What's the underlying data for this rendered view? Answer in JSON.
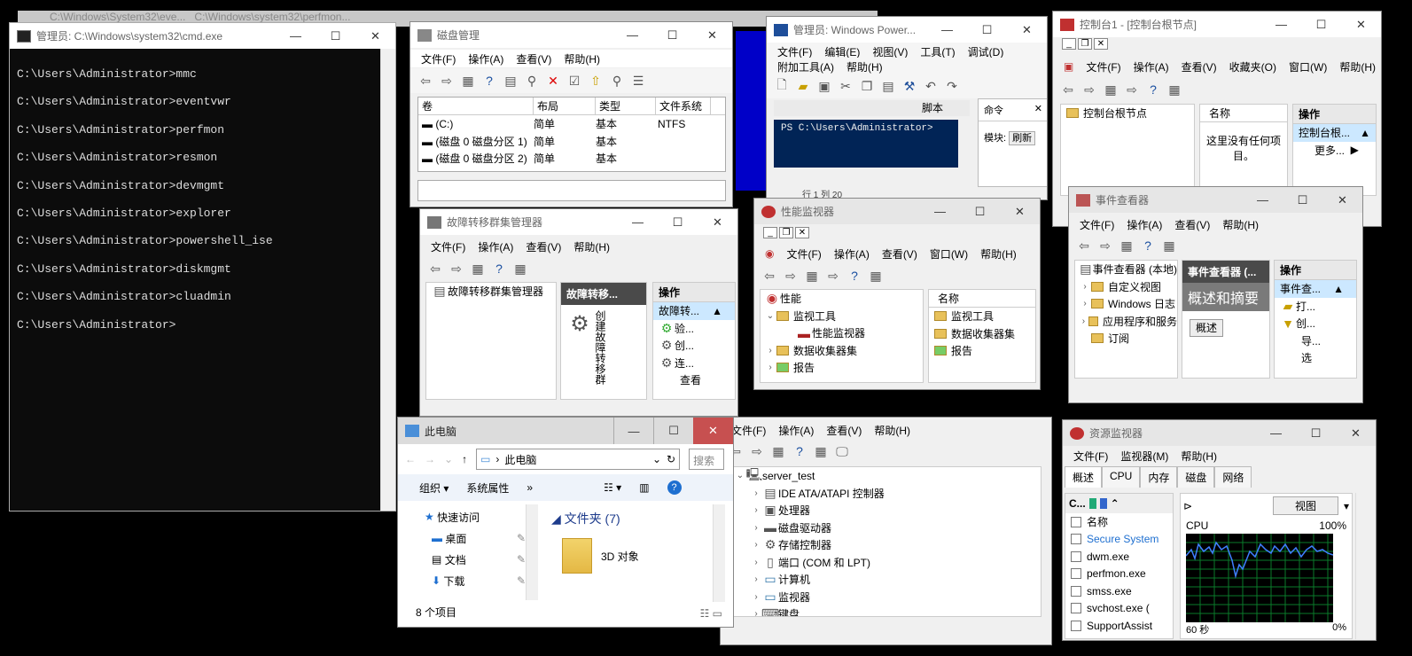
{
  "back_titles": {
    "a": "C:\\Windows\\System32\\eve...",
    "b": "C:\\Windows\\system32\\perfmon..."
  },
  "cmd": {
    "title": "管理员: C:\\Windows\\system32\\cmd.exe",
    "lines": [
      "C:\\Users\\Administrator>mmc",
      "C:\\Users\\Administrator>eventvwr",
      "C:\\Users\\Administrator>perfmon",
      "C:\\Users\\Administrator>resmon",
      "C:\\Users\\Administrator>devmgmt",
      "C:\\Users\\Administrator>explorer",
      "C:\\Users\\Administrator>powershell_ise",
      "C:\\Users\\Administrator>diskmgmt",
      "C:\\Users\\Administrator>cluadmin",
      "C:\\Users\\Administrator>"
    ]
  },
  "disk": {
    "title": "磁盘管理",
    "menu": [
      "文件(F)",
      "操作(A)",
      "查看(V)",
      "帮助(H)"
    ],
    "cols": [
      "卷",
      "布局",
      "类型",
      "文件系统"
    ],
    "rows": [
      [
        "(C:)",
        "简单",
        "基本",
        "NTFS"
      ],
      [
        "(磁盘 0 磁盘分区 1)",
        "简单",
        "基本",
        ""
      ],
      [
        "(磁盘 0 磁盘分区 2)",
        "简单",
        "基本",
        ""
      ]
    ]
  },
  "ps": {
    "title": "管理员: Windows Power...",
    "menu1": [
      "文件(F)",
      "编辑(E)",
      "视图(V)",
      "工具(T)",
      "调试(D)"
    ],
    "menu2": [
      "附加工具(A)",
      "帮助(H)"
    ],
    "script_label": "脚本",
    "prompt": "PS C:\\Users\\Administrator>",
    "cmd_tab": "命令",
    "module_label": "模块:",
    "module_value": "刷新",
    "status": "行 1  列 20"
  },
  "mmc": {
    "title": "控制台1 - [控制台根节点]",
    "menu": [
      "文件(F)",
      "操作(A)",
      "查看(V)",
      "收藏夹(O)",
      "窗口(W)",
      "帮助(H)"
    ],
    "tree_root": "控制台根节点",
    "col_name": "名称",
    "empty": "这里没有任何项目。",
    "actions_header": "操作",
    "action_selected": "控制台根...",
    "action_more": "更多..."
  },
  "cluster": {
    "title": "故障转移群集管理器",
    "menu": [
      "文件(F)",
      "操作(A)",
      "查看(V)",
      "帮助(H)"
    ],
    "tree_root": "故障转移群集管理器",
    "center_header": "故障转移...",
    "create_text": "创建故障转移群",
    "actions_header": "操作",
    "action_selected": "故障转...",
    "actions": [
      "验...",
      "创...",
      "连...",
      "查看"
    ]
  },
  "perf": {
    "title": "性能监视器",
    "menu": [
      "文件(F)",
      "操作(A)",
      "查看(V)",
      "窗口(W)",
      "帮助(H)"
    ],
    "tree": [
      "性能",
      "监视工具",
      "性能监视器",
      "数据收集器集",
      "报告"
    ],
    "col_name": "名称",
    "items": [
      "监视工具",
      "数据收集器集",
      "报告"
    ]
  },
  "event": {
    "title": "事件查看器",
    "menu": [
      "文件(F)",
      "操作(A)",
      "查看(V)",
      "帮助(H)"
    ],
    "tree": [
      "事件查看器 (本地)",
      "自定义视图",
      "Windows 日志",
      "应用程序和服务",
      "订阅"
    ],
    "center_header": "事件查看器 (...",
    "overview": "概述和摘要",
    "overview_btn": "概述",
    "actions_header": "操作",
    "action_selected": "事件查...",
    "actions": [
      "打...",
      "创...",
      "导...",
      "选"
    ]
  },
  "devmgr": {
    "menu": [
      "文件(F)",
      "操作(A)",
      "查看(V)",
      "帮助(H)"
    ],
    "root": "server_test",
    "items": [
      "IDE ATA/ATAPI 控制器",
      "处理器",
      "磁盘驱动器",
      "存储控制器",
      "端口 (COM 和 LPT)",
      "计算机",
      "监视器",
      "键盘"
    ]
  },
  "explorer": {
    "title": "此电脑",
    "address": "此电脑",
    "search_placeholder": "搜索",
    "ribbon": [
      "组织",
      "系统属性",
      "»"
    ],
    "nav": [
      "快速访问",
      "桌面",
      "文档",
      "下载"
    ],
    "group_header": "文件夹 (7)",
    "folder": "3D 对象",
    "status": "8 个项目"
  },
  "resmon": {
    "title": "资源监视器",
    "menu": [
      "文件(F)",
      "监视器(M)",
      "帮助(H)"
    ],
    "tabs": [
      "概述",
      "CPU",
      "内存",
      "磁盘",
      "网络"
    ],
    "section": "C...",
    "col_name": "名称",
    "procs": [
      "Secure System",
      "dwm.exe",
      "perfmon.exe",
      "smss.exe",
      "svchost.exe (",
      "SupportAssist"
    ],
    "view_btn": "视图",
    "graph_title": "CPU",
    "graph_max": "100%",
    "graph_time": "60 秒",
    "graph_min": "0%"
  },
  "colors": {
    "cmd_bg": "#0c0c0c",
    "ps_bg": "#012456",
    "graph_bg": "#000",
    "graph_line": "#3f7fff",
    "graph_grid": "#0a7a2a",
    "desktop": "#0000c8"
  }
}
